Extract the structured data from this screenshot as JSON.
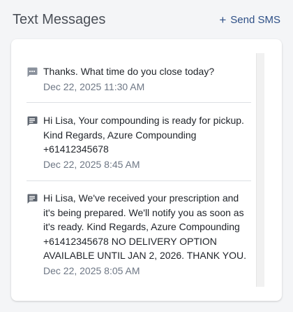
{
  "header": {
    "title": "Text Messages",
    "send_label": "Send SMS",
    "send_icon": "+"
  },
  "colors": {
    "accent": "#2d4f86",
    "timestamp": "#6e7785",
    "icon_incoming": "#8a919c",
    "icon_outgoing": "#5f6670"
  },
  "messages": [
    {
      "icon": "sms-dots-icon",
      "text": "Thanks. What time do you close today?",
      "time": "Dec 22, 2025 11:30 AM"
    },
    {
      "icon": "message-icon",
      "text": "Hi Lisa, Your compounding is ready for pickup. Kind Regards, Azure Compounding +61412345678",
      "time": "Dec 22, 2025 8:45 AM"
    },
    {
      "icon": "message-icon",
      "text": "Hi Lisa, We've received your prescription and it's being prepared. We'll notify you as soon as it's ready. Kind Regards, Azure Compounding +61412345678 NO DELIVERY OPTION AVAILABLE UNTIL JAN 2, 2026. THANK YOU.",
      "time": "Dec 22, 2025 8:05 AM"
    }
  ]
}
